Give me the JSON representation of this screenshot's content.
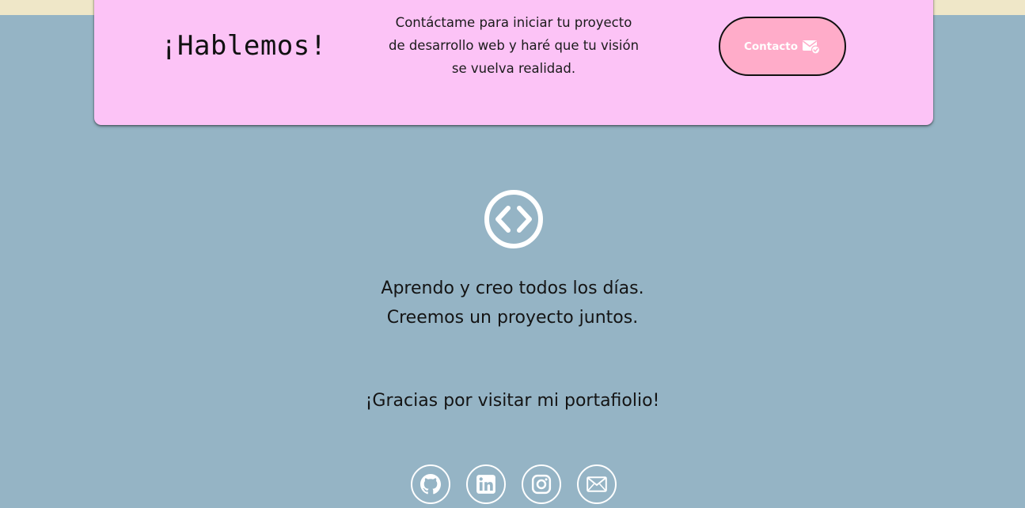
{
  "cta": {
    "title": "¡Hablemos!",
    "description": "Contáctame para iniciar tu proyecto de desarrollo web y haré que tu visión se vuelva realidad.",
    "button_label": "Contacto",
    "button_icon": "mail-check-icon"
  },
  "footer": {
    "logo_icon": "code-icon",
    "line1": "Aprendo y creo todos los días.",
    "line2": "Creemos un proyecto juntos.",
    "thanks": "¡Gracias por visitar mi portafiolio!"
  },
  "social": [
    {
      "icon": "github-icon"
    },
    {
      "icon": "linkedin-icon"
    },
    {
      "icon": "instagram-icon"
    },
    {
      "icon": "email-icon"
    }
  ],
  "colors": {
    "background": "#95b4c5",
    "top_strip": "#efe7c8",
    "card": "#fcc3f6",
    "button": "#ffacc9",
    "icon_stroke": "#ffffff",
    "text": "#141414"
  }
}
